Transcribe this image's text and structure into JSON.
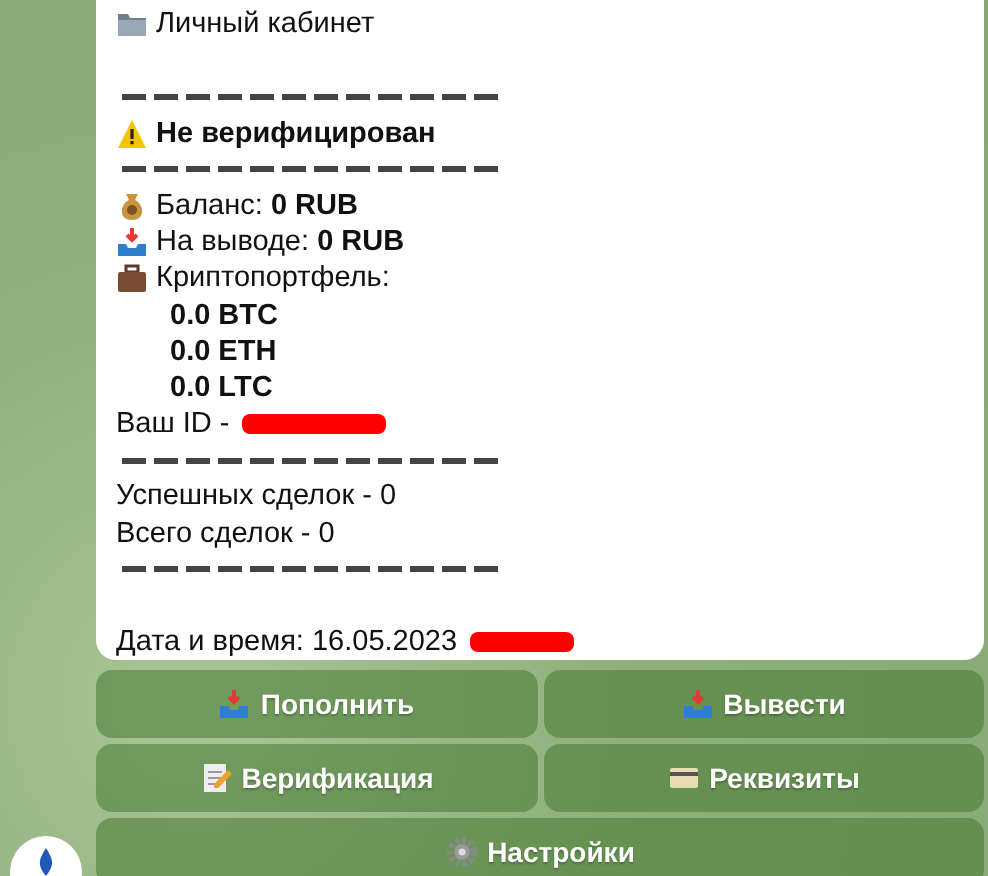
{
  "message": {
    "title": "Личный кабинет",
    "status": "Не верифицирован",
    "balances": [
      {
        "label": "Баланс:",
        "value": "0 RUB"
      },
      {
        "label": "На выводе:",
        "value": "0 RUB"
      }
    ],
    "crypto_label": "Криптопортфель:",
    "crypto": [
      "0.0 BTC",
      "0.0 ETH",
      "0.0 LTC"
    ],
    "id_label": "Ваш  ID -",
    "stats": [
      "Успешных сделок - 0",
      "Всего сделок - 0"
    ],
    "datetime": "Дата и время: 16.05.2023"
  },
  "keyboard": [
    [
      "Пополнить",
      "Вывести"
    ],
    [
      "Верификация",
      "Реквизиты"
    ],
    [
      "Настройки"
    ]
  ]
}
